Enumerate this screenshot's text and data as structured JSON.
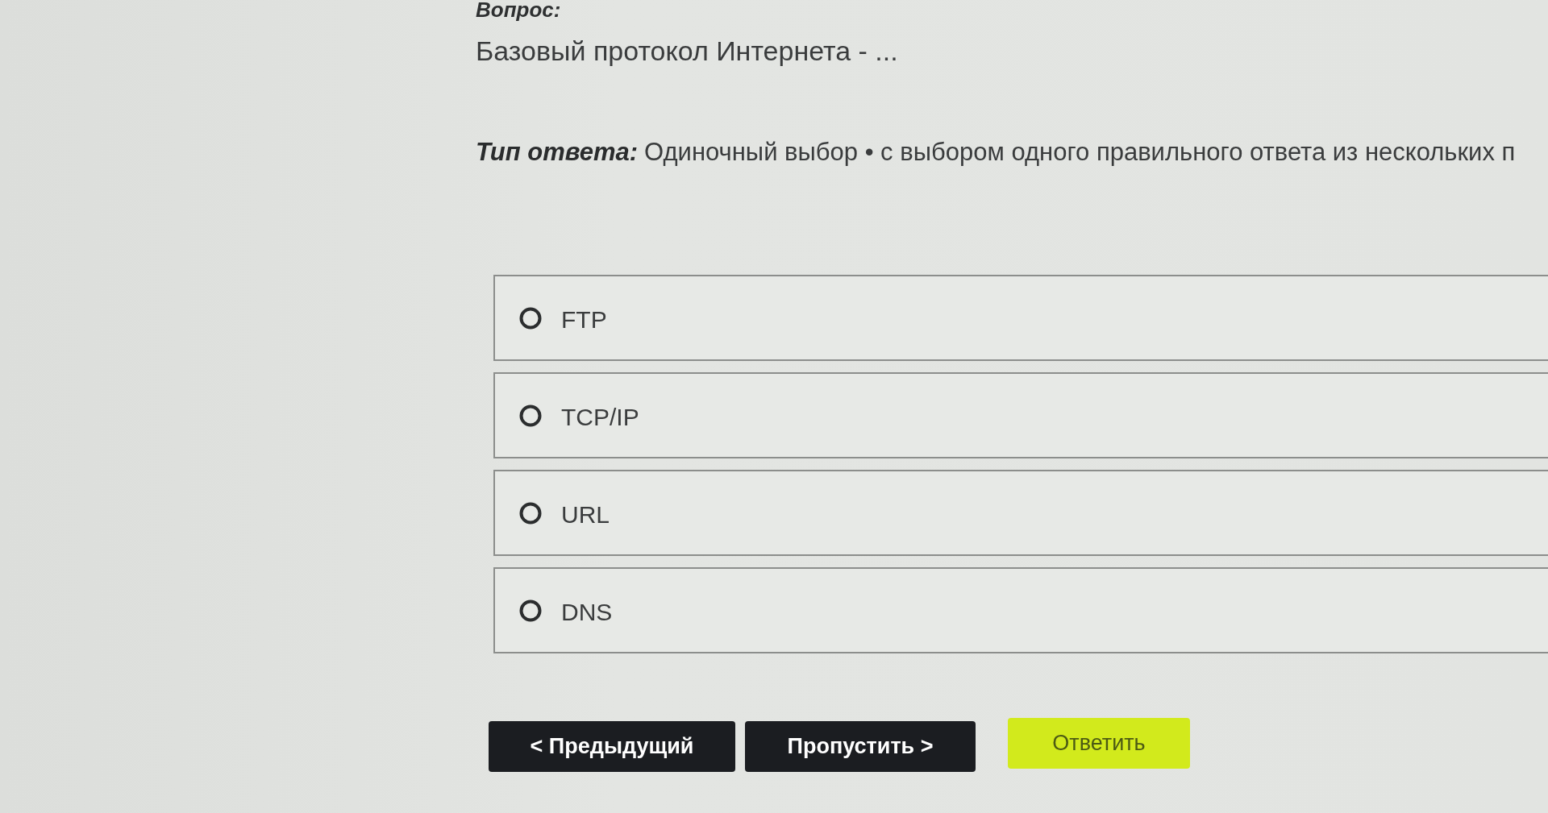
{
  "question": {
    "label": "Вопрос:",
    "text": "Базовый протокол Интернета - ..."
  },
  "answer_type": {
    "label": "Тип ответа:",
    "text": "Одиночный выбор • с выбором одного правильного ответа из нескольких п"
  },
  "options": [
    {
      "label": "FTP",
      "selected": false
    },
    {
      "label": "TCP/IP",
      "selected": false
    },
    {
      "label": "URL",
      "selected": false
    },
    {
      "label": "DNS",
      "selected": false
    }
  ],
  "buttons": [
    {
      "label": "< Предыдущий",
      "kind": "secondary"
    },
    {
      "label": "Пропустить >",
      "kind": "secondary"
    },
    {
      "label": "Ответить",
      "kind": "primary"
    }
  ]
}
